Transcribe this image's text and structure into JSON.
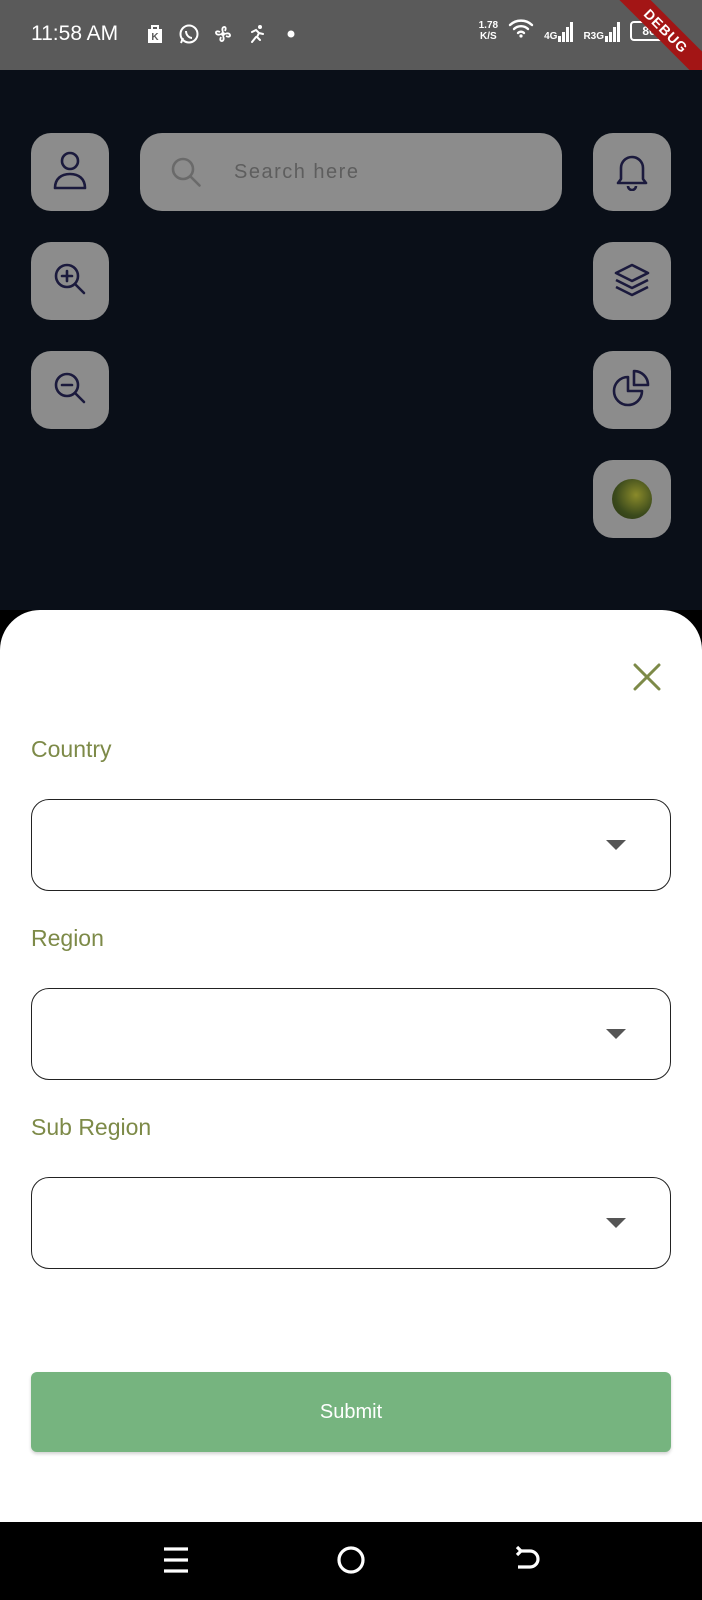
{
  "status_bar": {
    "time": "11:58 AM",
    "net_speed_value": "1.78",
    "net_speed_unit": "K/S",
    "network_1": "4G",
    "network_2": "R3G",
    "battery": "80",
    "debug_banner": "DEBUG",
    "left_icons": [
      "k-app-icon",
      "whatsapp-icon",
      "fan-icon",
      "runner-icon",
      "dot-icon"
    ]
  },
  "map": {
    "search": {
      "placeholder": "Search here"
    },
    "left_controls": [
      "profile-icon",
      "zoom-in-icon",
      "zoom-out-icon"
    ],
    "right_controls": [
      "bell-icon",
      "layers-icon",
      "pie-chart-icon",
      "avatar"
    ]
  },
  "sheet": {
    "fields": [
      {
        "label": "Country",
        "value": ""
      },
      {
        "label": "Region",
        "value": ""
      },
      {
        "label": "Sub Region",
        "value": ""
      }
    ],
    "submit_label": "Submit"
  },
  "nav_bar": {
    "buttons": [
      "menu-icon",
      "home-icon",
      "back-icon"
    ]
  },
  "colors": {
    "label": "#7d8a48",
    "submit_bg": "#76b47f",
    "control_bg": "#8c8c8c",
    "map_bg": "#0a0f18",
    "debug_banner": "#a31515",
    "icon_stroke": "#1b1a3d"
  }
}
